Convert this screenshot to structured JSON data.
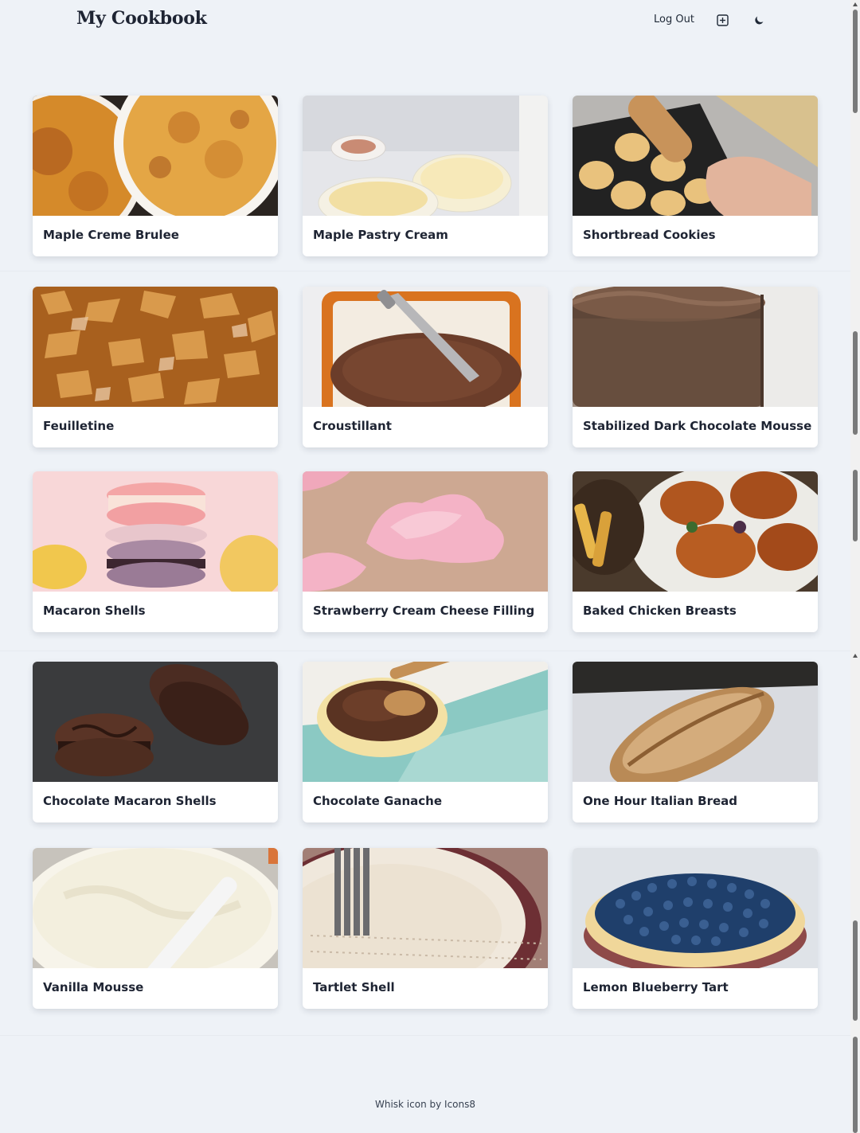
{
  "header": {
    "brand": "My Cookbook",
    "logout_label": "Log Out",
    "add_icon": "plus-square-icon",
    "theme_icon": "moon-icon"
  },
  "recipes": [
    {
      "title": "Maple Creme Brulee"
    },
    {
      "title": "Maple Pastry Cream"
    },
    {
      "title": "Shortbread Cookies"
    },
    {
      "title": "Feuilletine"
    },
    {
      "title": "Croustillant"
    },
    {
      "title": "Stabilized Dark Chocolate Mousse"
    },
    {
      "title": "Macaron Shells"
    },
    {
      "title": "Strawberry Cream Cheese Filling"
    },
    {
      "title": "Baked Chicken Breasts"
    },
    {
      "title": "Chocolate Macaron Shells"
    },
    {
      "title": "Chocolate Ganache"
    },
    {
      "title": "One Hour Italian Bread"
    },
    {
      "title": "Vanilla Mousse"
    },
    {
      "title": "Tartlet Shell"
    },
    {
      "title": "Lemon Blueberry Tart"
    }
  ],
  "footer": {
    "credit": "Whisk icon by Icons8"
  },
  "colors": {
    "page_bg": "#eef2f7",
    "card_bg": "#ffffff",
    "text": "#1e2433"
  }
}
